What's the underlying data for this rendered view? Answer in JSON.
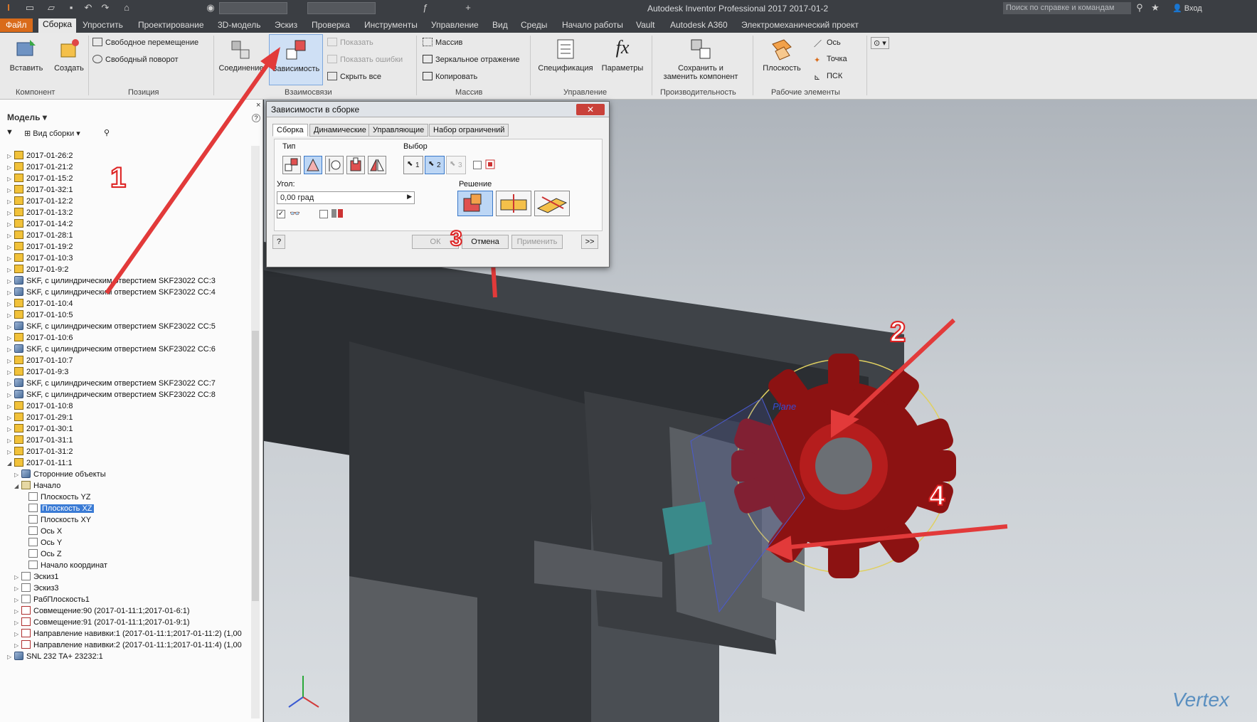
{
  "titlebar": {
    "title": "Autodesk Inventor Professional 2017   2017-01-2",
    "search_placeholder": "Поиск по справке и командам",
    "login": "Вход"
  },
  "menu": {
    "tabs": [
      "Файл",
      "Сборка",
      "Упростить",
      "Проектирование",
      "3D-модель",
      "Эскиз",
      "Проверка",
      "Инструменты",
      "Управление",
      "Вид",
      "Среды",
      "Начало работы",
      "Vault",
      "Autodesk A360",
      "Электромеханический проект"
    ],
    "active": "Сборка"
  },
  "ribbon": {
    "component": {
      "insert": "Вставить",
      "create": "Создать",
      "label": "Компонент"
    },
    "position": {
      "free_move": "Свободное перемещение",
      "free_rotate": "Свободный поворот",
      "label": "Позиция"
    },
    "relations": {
      "joint": "Соединение",
      "constraint": "Зависимость",
      "show": "Показать",
      "show_errors": "Показать ошибки",
      "hide_all": "Скрыть все",
      "label": "Взаимосвязи"
    },
    "pattern": {
      "array": "Массив",
      "mirror": "Зеркальное отражение",
      "copy": "Копировать",
      "label": "Массив"
    },
    "manage": {
      "bom": "Спецификация",
      "params": "Параметры",
      "label": "Управление"
    },
    "productivity": {
      "save_replace_1": "Сохранить и",
      "save_replace_2": "заменить компонент",
      "label": "Производительность"
    },
    "work": {
      "plane": "Плоскость",
      "axis": "Ось",
      "point": "Точка",
      "ucs": "ПСК",
      "label": "Рабочие элементы"
    }
  },
  "browser": {
    "header": "Модель",
    "view": "Вид сборки",
    "items": [
      {
        "label": "2017-01-26:2",
        "icon": "part-icon",
        "level": 0
      },
      {
        "label": "2017-01-21:2",
        "icon": "part-icon",
        "level": 0
      },
      {
        "label": "2017-01-15:2",
        "icon": "part-icon",
        "level": 0
      },
      {
        "label": "2017-01-32:1",
        "icon": "part-icon",
        "level": 0
      },
      {
        "label": "2017-01-12:2",
        "icon": "part-icon",
        "level": 0
      },
      {
        "label": "2017-01-13:2",
        "icon": "part-icon",
        "level": 0
      },
      {
        "label": "2017-01-14:2",
        "icon": "part-icon",
        "level": 0
      },
      {
        "label": "2017-01-28:1",
        "icon": "part-icon",
        "level": 0
      },
      {
        "label": "2017-01-19:2",
        "icon": "part-icon",
        "level": 0
      },
      {
        "label": "2017-01-10:3",
        "icon": "part-icon",
        "level": 0
      },
      {
        "label": "2017-01-9:2",
        "icon": "part-icon",
        "level": 0
      },
      {
        "label": "SKF, с цилиндрическим отверстием SKF23022 CC:3",
        "icon": "asm-icon",
        "level": 0
      },
      {
        "label": "SKF, с цилиндрическим отверстием SKF23022 CC:4",
        "icon": "asm-icon",
        "level": 0
      },
      {
        "label": "2017-01-10:4",
        "icon": "part-icon",
        "level": 0
      },
      {
        "label": "2017-01-10:5",
        "icon": "part-icon",
        "level": 0
      },
      {
        "label": "SKF, с цилиндрическим отверстием SKF23022 CC:5",
        "icon": "asm-icon",
        "level": 0
      },
      {
        "label": "2017-01-10:6",
        "icon": "part-icon",
        "level": 0
      },
      {
        "label": "SKF, с цилиндрическим отверстием SKF23022 CC:6",
        "icon": "asm-icon",
        "level": 0
      },
      {
        "label": "2017-01-10:7",
        "icon": "part-icon",
        "level": 0
      },
      {
        "label": "2017-01-9:3",
        "icon": "part-icon",
        "level": 0
      },
      {
        "label": "SKF, с цилиндрическим отверстием SKF23022 CC:7",
        "icon": "asm-icon",
        "level": 0
      },
      {
        "label": "SKF, с цилиндрическим отверстием SKF23022 CC:8",
        "icon": "asm-icon",
        "level": 0
      },
      {
        "label": "2017-01-10:8",
        "icon": "part-icon",
        "level": 0
      },
      {
        "label": "2017-01-29:1",
        "icon": "part-icon",
        "level": 0
      },
      {
        "label": "2017-01-30:1",
        "icon": "part-icon",
        "level": 0
      },
      {
        "label": "2017-01-31:1",
        "icon": "part-icon",
        "level": 0
      },
      {
        "label": "2017-01-31:2",
        "icon": "part-icon",
        "level": 0
      },
      {
        "label": "2017-01-11:1",
        "icon": "part-icon",
        "level": 0,
        "expanded": true
      },
      {
        "label": "Сторонние объекты",
        "icon": "asm-icon",
        "level": 1
      },
      {
        "label": "Начало",
        "icon": "folder-icon",
        "level": 1,
        "expanded": true
      },
      {
        "label": "Плоскость YZ",
        "icon": "plane-icon",
        "level": 2
      },
      {
        "label": "Плоскость XZ",
        "icon": "plane-icon",
        "level": 2,
        "selected": true
      },
      {
        "label": "Плоскость XY",
        "icon": "plane-icon",
        "level": 2
      },
      {
        "label": "Ось X",
        "icon": "plane-icon",
        "level": 2
      },
      {
        "label": "Ось Y",
        "icon": "plane-icon",
        "level": 2
      },
      {
        "label": "Ось Z",
        "icon": "plane-icon",
        "level": 2
      },
      {
        "label": "Начало координат",
        "icon": "point-icon",
        "level": 2
      },
      {
        "label": "Эскиз1",
        "icon": "sketch-icon",
        "level": 1
      },
      {
        "label": "Эскиз3",
        "icon": "sketch-icon",
        "level": 1
      },
      {
        "label": "РабПлоскость1",
        "icon": "plane-icon",
        "level": 1
      },
      {
        "label": "Совмещение:90 (2017-01-11:1;2017-01-6:1)",
        "icon": "constraint-icon",
        "level": 1
      },
      {
        "label": "Совмещение:91 (2017-01-11:1;2017-01-9:1)",
        "icon": "constraint-icon",
        "level": 1
      },
      {
        "label": "Направление навивки:1 (2017-01-11:1;2017-01-11:2) (1,00",
        "icon": "constraint-icon",
        "level": 1
      },
      {
        "label": "Направление навивки:2 (2017-01-11:1;2017-01-11:4) (1,00",
        "icon": "constraint-icon",
        "level": 1
      },
      {
        "label": "SNL 232 TA+ 23232:1",
        "icon": "asm-icon",
        "level": 0
      }
    ]
  },
  "dialog": {
    "title": "Зависимости в сборке",
    "tabs": [
      "Сборка",
      "Динамические",
      "Управляющие",
      "Набор ограничений"
    ],
    "type_label": "Тип",
    "selection_label": "Выбор",
    "angle_label": "Угол:",
    "angle_value": "0,00 град",
    "solution_label": "Решение",
    "ok": "ОК",
    "cancel": "Отмена",
    "apply": "Применить",
    "more": ">>",
    "help": "?",
    "sel1": "1",
    "sel2": "2",
    "sel3": "3"
  },
  "callouts": [
    "1",
    "2",
    "3",
    "4"
  ],
  "viewport": {
    "plane_label": "Plane"
  },
  "watermark": "Vertex",
  "colors": {
    "accent": "#d96b1a",
    "arrow": "#e23a3a",
    "sprocket": "#8c1212",
    "highlight": "#3a7bd5"
  }
}
